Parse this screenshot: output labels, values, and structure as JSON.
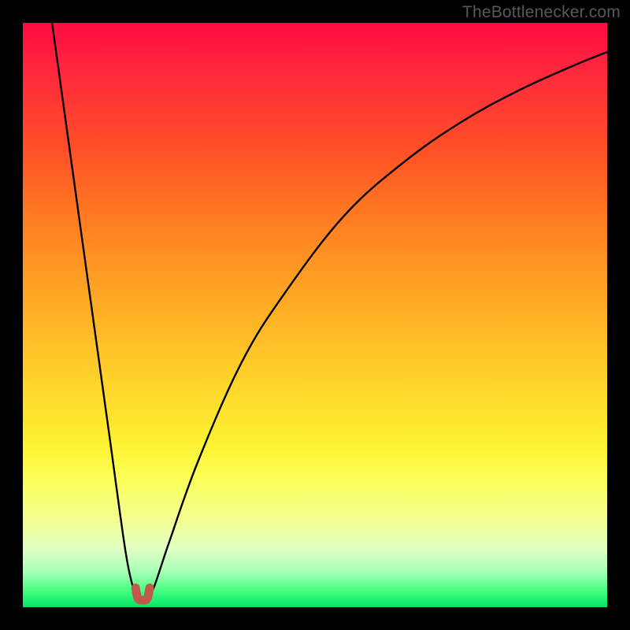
{
  "watermark": "TheBottlenecker.com",
  "colors": {
    "marker_stroke": "#c05a4f"
  },
  "chart_data": {
    "type": "line",
    "title": "",
    "xlabel": "",
    "ylabel": "",
    "xlim": [
      0,
      100
    ],
    "ylim": [
      0,
      100
    ],
    "series": [
      {
        "name": "curve",
        "x": [
          5,
          7.5,
          10,
          12.5,
          15,
          17.5,
          18.8,
          19.6,
          20.5,
          21.3,
          22.5,
          25,
          30,
          37.5,
          45,
          55,
          65,
          75,
          85,
          95,
          100
        ],
        "y": [
          100,
          82,
          64,
          46,
          28,
          10,
          3.6,
          1.5,
          1.3,
          1.5,
          3.6,
          11,
          25,
          42,
          54,
          67,
          76,
          83,
          88.5,
          93,
          95
        ]
      }
    ],
    "marker": {
      "name": "u-marker",
      "x": [
        19.3,
        19.7,
        20.5,
        21.3,
        21.7
      ],
      "y": [
        3.3,
        1.5,
        1.2,
        1.5,
        3.3
      ]
    }
  }
}
